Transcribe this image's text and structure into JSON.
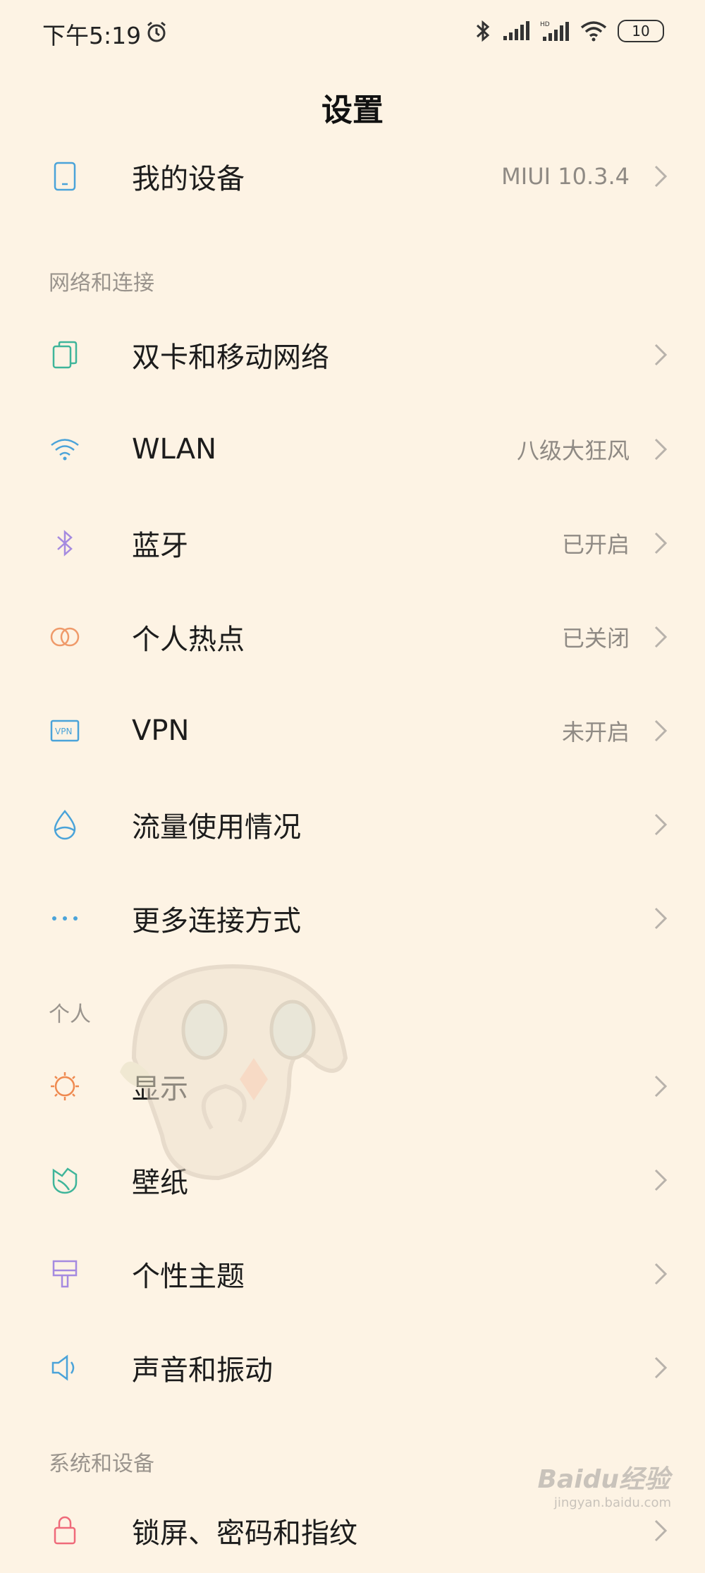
{
  "status_bar": {
    "time": "下午5:19",
    "battery": "10"
  },
  "page_title": "设置",
  "my_device": {
    "label": "我的设备",
    "value": "MIUI 10.3.4"
  },
  "sections": {
    "network": "网络和连接",
    "personal": "个人",
    "system": "系统和设备"
  },
  "network_items": [
    {
      "label": "双卡和移动网络",
      "value": ""
    },
    {
      "label": "WLAN",
      "value": "八级大狂风"
    },
    {
      "label": "蓝牙",
      "value": "已开启"
    },
    {
      "label": "个人热点",
      "value": "已关闭"
    },
    {
      "label": "VPN",
      "value": "未开启"
    },
    {
      "label": "流量使用情况",
      "value": ""
    },
    {
      "label": "更多连接方式",
      "value": ""
    }
  ],
  "personal_items": [
    {
      "label": "显示",
      "value": ""
    },
    {
      "label": "壁纸",
      "value": ""
    },
    {
      "label": "个性主题",
      "value": ""
    },
    {
      "label": "声音和振动",
      "value": ""
    }
  ],
  "system_items": [
    {
      "label": "锁屏、密码和指纹",
      "value": ""
    }
  ],
  "watermark": {
    "brand": "Baidu经验",
    "url": "jingyan.baidu.com"
  },
  "colors": {
    "background": "#fdf3e4",
    "chevron": "#b8b2ab"
  }
}
